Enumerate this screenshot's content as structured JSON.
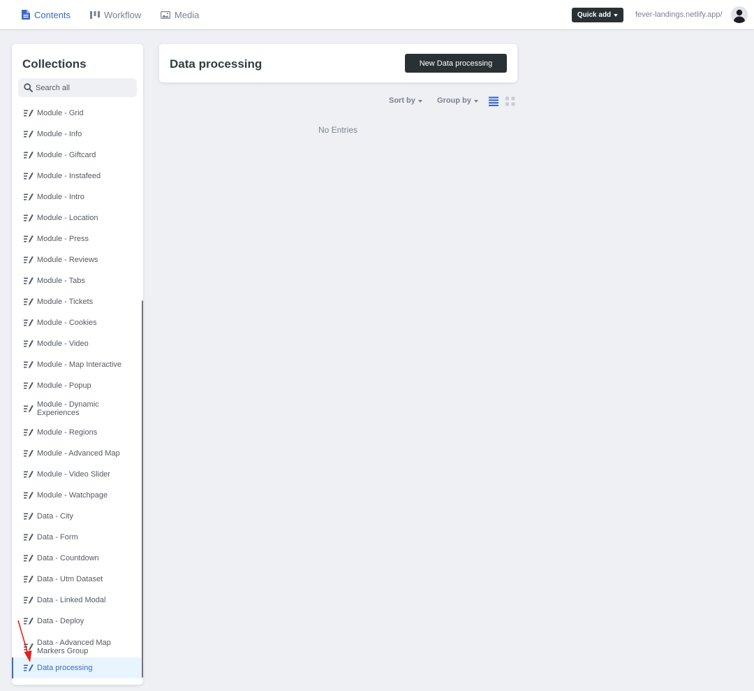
{
  "topbar": {
    "nav": [
      {
        "label": "Contents",
        "icon": "document-icon",
        "active": true
      },
      {
        "label": "Workflow",
        "icon": "kanban-icon",
        "active": false
      },
      {
        "label": "Media",
        "icon": "image-icon",
        "active": false
      }
    ],
    "quick_add_label": "Quick add",
    "site_url": "fever-landings.netlify.app/",
    "avatar_icon": "user-avatar-icon"
  },
  "sidebar": {
    "title": "Collections",
    "search_placeholder": "Search all",
    "items": [
      {
        "label": "Module - Grid"
      },
      {
        "label": "Module - Info"
      },
      {
        "label": "Module - Giftcard"
      },
      {
        "label": "Module - Instafeed"
      },
      {
        "label": "Module - Intro"
      },
      {
        "label": "Module - Location"
      },
      {
        "label": "Module - Press"
      },
      {
        "label": "Module - Reviews"
      },
      {
        "label": "Module - Tabs"
      },
      {
        "label": "Module - Tickets"
      },
      {
        "label": "Module - Cookies"
      },
      {
        "label": "Module - Video"
      },
      {
        "label": "Module - Map Interactive"
      },
      {
        "label": "Module - Popup"
      },
      {
        "label": "Module - Dynamic Experiences"
      },
      {
        "label": "Module - Regions"
      },
      {
        "label": "Module - Advanced Map"
      },
      {
        "label": "Module - Video Slider"
      },
      {
        "label": "Module - Watchpage"
      },
      {
        "label": "Data - City"
      },
      {
        "label": "Data - Form"
      },
      {
        "label": "Data - Countdown"
      },
      {
        "label": "Data - Utm Dataset"
      },
      {
        "label": "Data - Linked Modal"
      },
      {
        "label": "Data - Deploy"
      },
      {
        "label": "Data - Advanced Map Markers Group"
      },
      {
        "label": "Data processing",
        "active": true
      }
    ]
  },
  "main": {
    "title": "Data processing",
    "new_button_label": "New Data processing",
    "sort_label": "Sort by",
    "group_label": "Group by",
    "empty_text": "No Entries"
  },
  "colors": {
    "accent": "#3a69c7",
    "dark_button": "#2a3134",
    "background": "#eff0f4",
    "annotation_arrow": "#e8211b"
  }
}
